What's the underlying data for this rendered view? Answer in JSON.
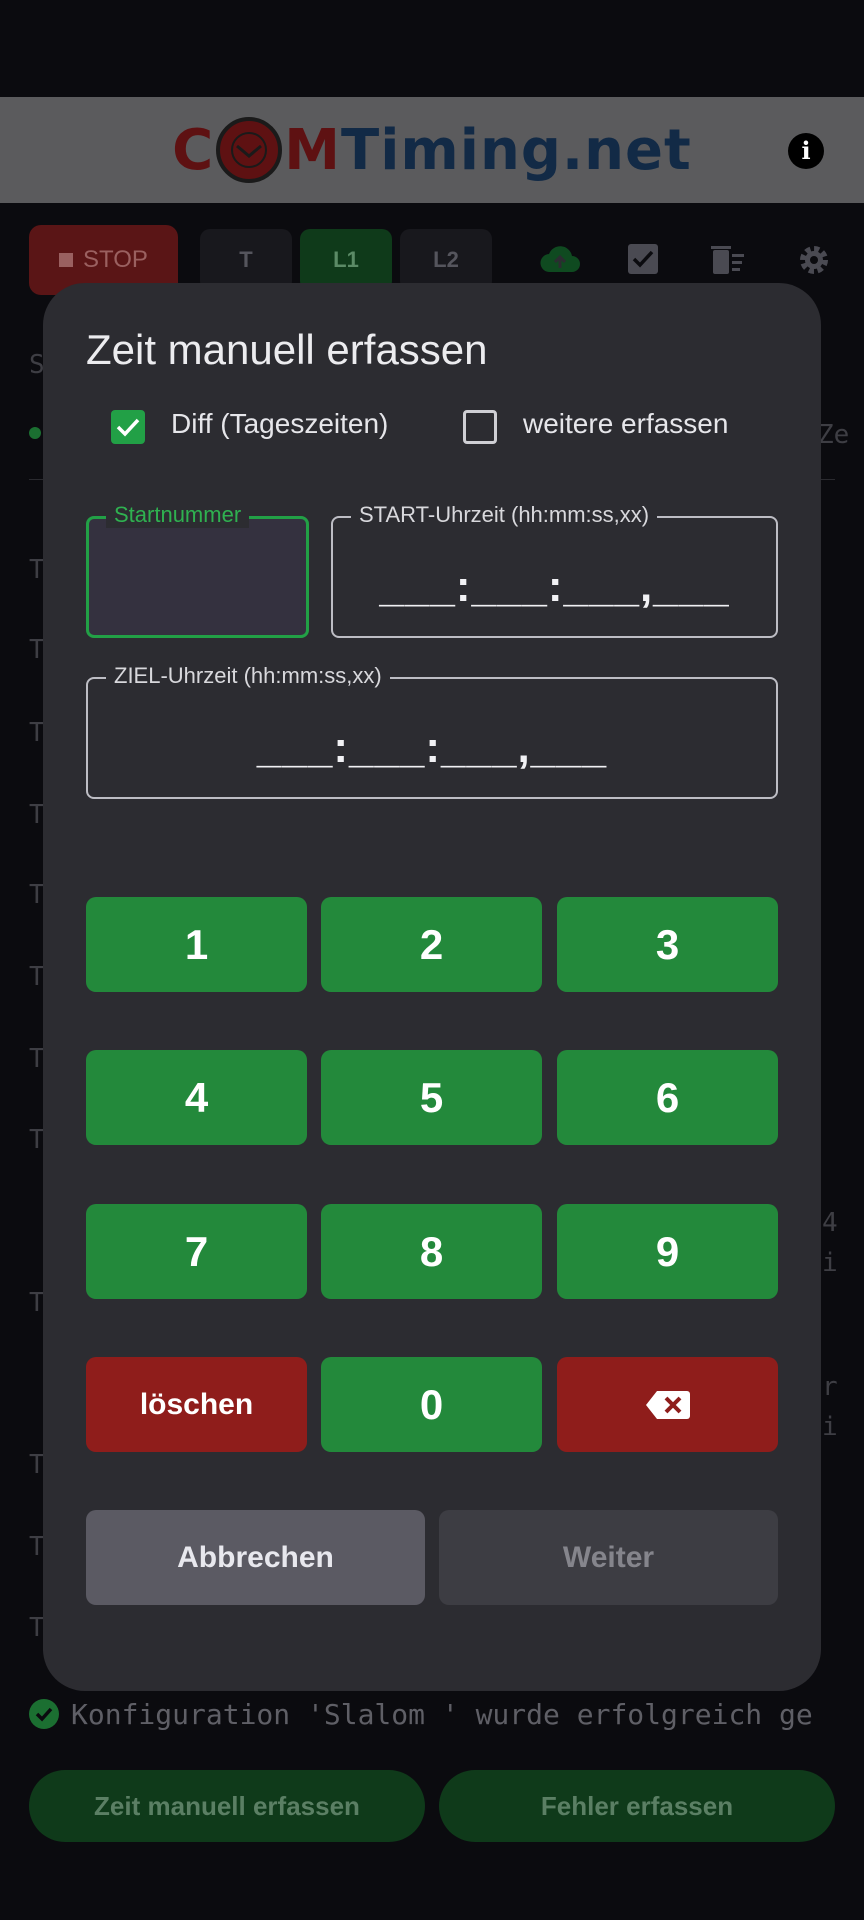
{
  "header": {
    "logo_c": "C",
    "logo_m": "M",
    "logo_rest": "Timing.net",
    "info_icon": "i"
  },
  "toolbar": {
    "stop_label": "STOP",
    "tabs": [
      {
        "label": "T",
        "active": false
      },
      {
        "label": "L1",
        "active": true
      },
      {
        "label": "L2",
        "active": false
      }
    ],
    "icons": [
      "cloud-upload-icon",
      "checkbox-icon",
      "delete-list-icon",
      "gear-icon"
    ]
  },
  "background": {
    "section_letter": "S",
    "right_snippet": "Ze",
    "row_letter": "T",
    "right_4": "4",
    "right_i": "i",
    "right_r": "r"
  },
  "status": {
    "text": "Konfiguration 'Slalom ' wurde erfolgreich ge"
  },
  "bottom": {
    "manual_label": "Zeit manuell erfassen",
    "error_label": "Fehler erfassen"
  },
  "dialog": {
    "title": "Zeit manuell erfassen",
    "diff_label": "Diff (Tageszeiten)",
    "diff_checked": true,
    "more_label": "weitere erfassen",
    "more_checked": false,
    "startnr_label": "Startnummer",
    "startnr_value": "",
    "start_label": "START-Uhrzeit (hh:mm:ss,xx)",
    "start_mask": "___:___:___,___",
    "ziel_label": "ZIEL-Uhrzeit (hh:mm:ss,xx)",
    "ziel_mask": "___:___:___,___",
    "keys": {
      "k1": "1",
      "k2": "2",
      "k3": "3",
      "k4": "4",
      "k5": "5",
      "k6": "6",
      "k7": "7",
      "k8": "8",
      "k9": "9",
      "clear": "löschen",
      "k0": "0"
    },
    "cancel_label": "Abbrechen",
    "next_label": "Weiter"
  },
  "colors": {
    "accent_green": "#23893b",
    "danger_red": "#8f1d1b",
    "dialog_bg": "#2c2c31"
  }
}
